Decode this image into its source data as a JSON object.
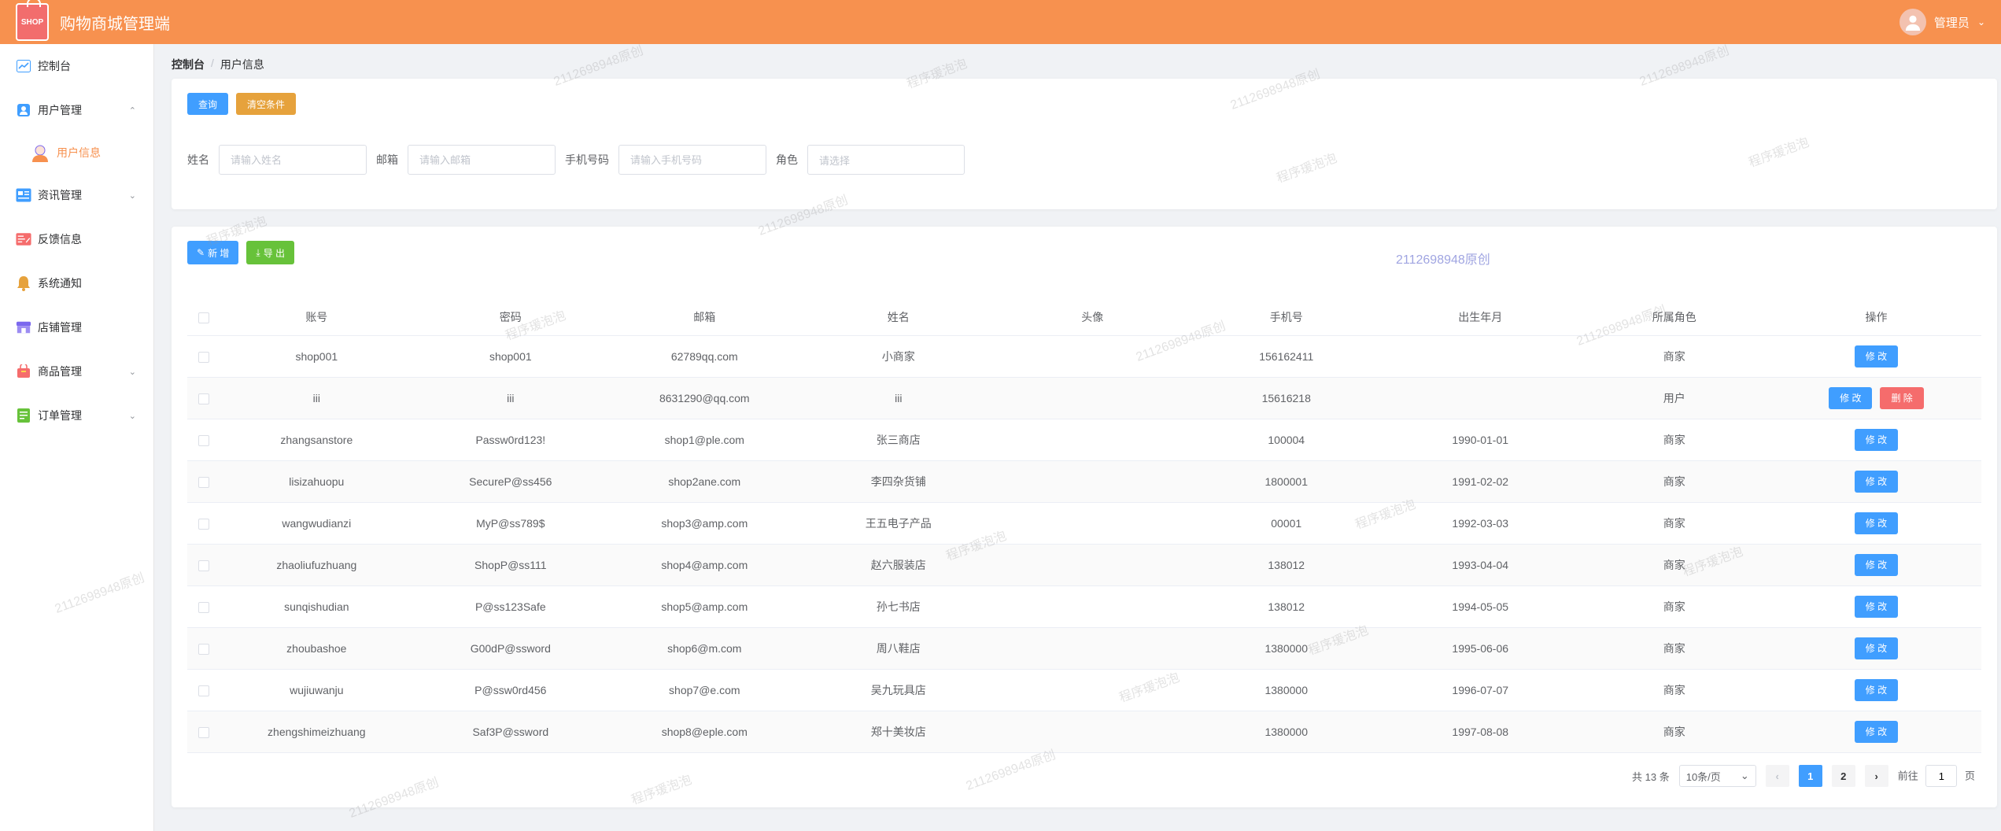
{
  "app": {
    "title": "购物商城管理端",
    "logo_text": "SHOP",
    "user_name": "管理员"
  },
  "sidebar": {
    "items": [
      {
        "label": "控制台",
        "icon": "dashboard-icon",
        "color": "#409eff"
      },
      {
        "label": "用户管理",
        "icon": "user-manage-icon",
        "color": "#409eff",
        "expanded": true
      },
      {
        "label": "用户信息",
        "icon": "user-avatar-icon",
        "color": "#f7914f",
        "sub": true,
        "active": true
      },
      {
        "label": "资讯管理",
        "icon": "news-icon",
        "color": "#409eff",
        "collapsed": true
      },
      {
        "label": "反馈信息",
        "icon": "feedback-icon",
        "color": "#f56c6c"
      },
      {
        "label": "系统通知",
        "icon": "bell-icon",
        "color": "#e6a23c"
      },
      {
        "label": "店铺管理",
        "icon": "store-icon",
        "color": "#7b68ee"
      },
      {
        "label": "商品管理",
        "icon": "goods-icon",
        "color": "#f56c6c",
        "collapsed": true
      },
      {
        "label": "订单管理",
        "icon": "order-icon",
        "color": "#67c23a",
        "collapsed": true
      }
    ]
  },
  "breadcrumb": [
    "控制台",
    "用户信息"
  ],
  "search": {
    "query_label": "查询",
    "reset_label": "清空条件",
    "fields": {
      "name_label": "姓名",
      "name_placeholder": "请输入姓名",
      "email_label": "邮箱",
      "email_placeholder": "请输入邮箱",
      "phone_label": "手机号码",
      "phone_placeholder": "请输入手机号码",
      "role_label": "角色",
      "role_placeholder": "请选择"
    }
  },
  "toolbar": {
    "add_label": "新 增",
    "export_label": "导 出"
  },
  "table": {
    "columns": [
      "账号",
      "密码",
      "邮箱",
      "姓名",
      "头像",
      "手机号",
      "出生年月",
      "所属角色",
      "操作"
    ],
    "rows": [
      {
        "account": "shop001",
        "password": "shop001",
        "email": "62789qq.com",
        "name": "小商家",
        "avatar": "",
        "phone": "156162411",
        "birth": "",
        "role": "商家",
        "ops": [
          "修 改"
        ]
      },
      {
        "account": "iii",
        "password": "iii",
        "email": "8631290@qq.com",
        "name": "iii",
        "avatar": "",
        "phone": "15616218",
        "birth": "",
        "role": "用户",
        "ops": [
          "修 改",
          "删 除"
        ]
      },
      {
        "account": "zhangsanstore",
        "password": "Passw0rd123!",
        "email": "shop1@ple.com",
        "name": "张三商店",
        "avatar": "",
        "phone": "100004",
        "birth": "1990-01-01",
        "role": "商家",
        "ops": [
          "修 改"
        ]
      },
      {
        "account": "lisizahuopu",
        "password": "SecureP@ss456",
        "email": "shop2ane.com",
        "name": "李四杂货铺",
        "avatar": "",
        "phone": "1800001",
        "birth": "1991-02-02",
        "role": "商家",
        "ops": [
          "修 改"
        ]
      },
      {
        "account": "wangwudianzi",
        "password": "MyP@ss789$",
        "email": "shop3@amp.com",
        "name": "王五电子产品",
        "avatar": "",
        "phone": "00001",
        "birth": "1992-03-03",
        "role": "商家",
        "ops": [
          "修 改"
        ]
      },
      {
        "account": "zhaoliufuzhuang",
        "password": "ShopP@ss111",
        "email": "shop4@amp.com",
        "name": "赵六服装店",
        "avatar": "",
        "phone": "138012",
        "birth": "1993-04-04",
        "role": "商家",
        "ops": [
          "修 改"
        ]
      },
      {
        "account": "sunqishudian",
        "password": "P@ss123Safe",
        "email": "shop5@amp.com",
        "name": "孙七书店",
        "avatar": "",
        "phone": "138012",
        "birth": "1994-05-05",
        "role": "商家",
        "ops": [
          "修 改"
        ]
      },
      {
        "account": "zhoubashoe",
        "password": "G00dP@ssword",
        "email": "shop6@m.com",
        "name": "周八鞋店",
        "avatar": "",
        "phone": "1380000",
        "birth": "1995-06-06",
        "role": "商家",
        "ops": [
          "修 改"
        ]
      },
      {
        "account": "wujiuwanju",
        "password": "P@ssw0rd456",
        "email": "shop7@e.com",
        "name": "吴九玩具店",
        "avatar": "",
        "phone": "1380000",
        "birth": "1996-07-07",
        "role": "商家",
        "ops": [
          "修 改"
        ]
      },
      {
        "account": "zhengshimeizhuang",
        "password": "Saf3P@ssword",
        "email": "shop8@eple.com",
        "name": "郑十美妆店",
        "avatar": "",
        "phone": "1380000",
        "birth": "1997-08-08",
        "role": "商家",
        "ops": [
          "修 改"
        ]
      }
    ]
  },
  "pagination": {
    "total_text": "共 13 条",
    "page_size": "10条/页",
    "pages": [
      "1",
      "2"
    ],
    "current": "1",
    "goto_prefix": "前往",
    "goto_value": "1",
    "goto_suffix": "页"
  },
  "watermarks": {
    "id_text": "2112698948原创",
    "brand_text": "程序瑗泡泡"
  },
  "colors": {
    "header": "#f7914f",
    "primary": "#409eff",
    "warning": "#e6a23c",
    "success": "#67c23a",
    "danger": "#f56c6c"
  }
}
